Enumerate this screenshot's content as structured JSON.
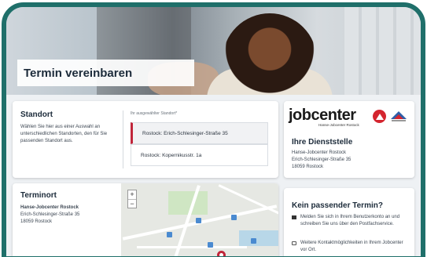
{
  "hero": {
    "title": "Termin vereinbaren"
  },
  "standort": {
    "heading": "Standort",
    "description": "Wählen Sie hier aus einer Auswahl an unterschiedlichen Standorten, den für Sie passenden Standort aus.",
    "list_label": "Ihr ausgewählter Standort*",
    "options": [
      {
        "label": "Rostock: Erich-Schlesinger-Straße 35",
        "selected": true
      },
      {
        "label": "Rostock: Kopernikusstr. 1a",
        "selected": false
      }
    ]
  },
  "dienststelle": {
    "logo_text": "jobcenter",
    "logo_sub": "Hanse-Jobcenter Rostock",
    "heading": "Ihre Dienststelle",
    "address": [
      "Hanse-Jobcenter Rostock",
      "Erich-Schlesinger-Straße 35",
      "18059 Rostock"
    ]
  },
  "terminort": {
    "heading": "Terminort",
    "name": "Hanse-Jobcenter Rostock",
    "street": "Erich-Schlesinger-Straße 35",
    "city": "18059 Rostock",
    "map": {
      "zoom_in": "+",
      "zoom_out": "−"
    }
  },
  "kein_termin": {
    "heading": "Kein passender Termin?",
    "items": [
      {
        "icon": "mail-icon",
        "text": "Melden Sie sich in Ihrem Benutzerkonto an und schreiben Sie uns über den Postfachservice."
      },
      {
        "icon": "external-link-icon",
        "text": "Weitere Kontaktmöglichkeiten in Ihrem Jobcenter vor Ort."
      }
    ]
  },
  "colors": {
    "frame": "#1f6f6a",
    "accent": "#c0253a",
    "logo_red": "#d4252f"
  }
}
